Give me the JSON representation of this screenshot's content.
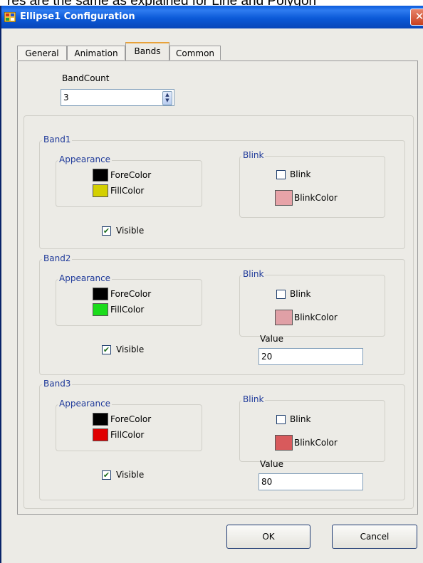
{
  "background_caption": "res are the same as explained for Line and Polygon",
  "window": {
    "title": "Ellipse1 Configuration",
    "close_icon": "close-icon",
    "app_icon": "app-icon"
  },
  "tabs": [
    {
      "label": "General",
      "selected": false
    },
    {
      "label": "Animation",
      "selected": false
    },
    {
      "label": "Bands",
      "selected": true
    },
    {
      "label": "Common",
      "selected": false
    }
  ],
  "band_count": {
    "label": "BandCount",
    "value": "3"
  },
  "bands": [
    {
      "title": "Band1",
      "appearance": {
        "title": "Appearance",
        "fore_label": "ForeColor",
        "fore_color": "#000000",
        "fill_label": "FillColor",
        "fill_color": "#d4d000"
      },
      "blink": {
        "title": "Blink",
        "checkbox_label": "Blink",
        "checked": false,
        "color_label": "BlinkColor",
        "color": "#e7a3a8"
      },
      "visible": {
        "label": "Visible",
        "checked": true
      }
    },
    {
      "title": "Band2",
      "appearance": {
        "title": "Appearance",
        "fore_label": "ForeColor",
        "fore_color": "#000000",
        "fill_label": "FillColor",
        "fill_color": "#1bdc1b"
      },
      "blink": {
        "title": "Blink",
        "checkbox_label": "Blink",
        "checked": false,
        "color_label": "BlinkColor",
        "color": "#e0a0a6"
      },
      "visible": {
        "label": "Visible",
        "checked": true
      },
      "value": {
        "label": "Value",
        "value": "20"
      }
    },
    {
      "title": "Band3",
      "appearance": {
        "title": "Appearance",
        "fore_label": "ForeColor",
        "fore_color": "#000000",
        "fill_label": "FillColor",
        "fill_color": "#e00000"
      },
      "blink": {
        "title": "Blink",
        "checkbox_label": "Blink",
        "checked": false,
        "color_label": "BlinkColor",
        "color": "#d85a5c"
      },
      "visible": {
        "label": "Visible",
        "checked": true
      },
      "value": {
        "label": "Value",
        "value": "80"
      }
    }
  ],
  "buttons": {
    "ok": "OK",
    "cancel": "Cancel"
  }
}
